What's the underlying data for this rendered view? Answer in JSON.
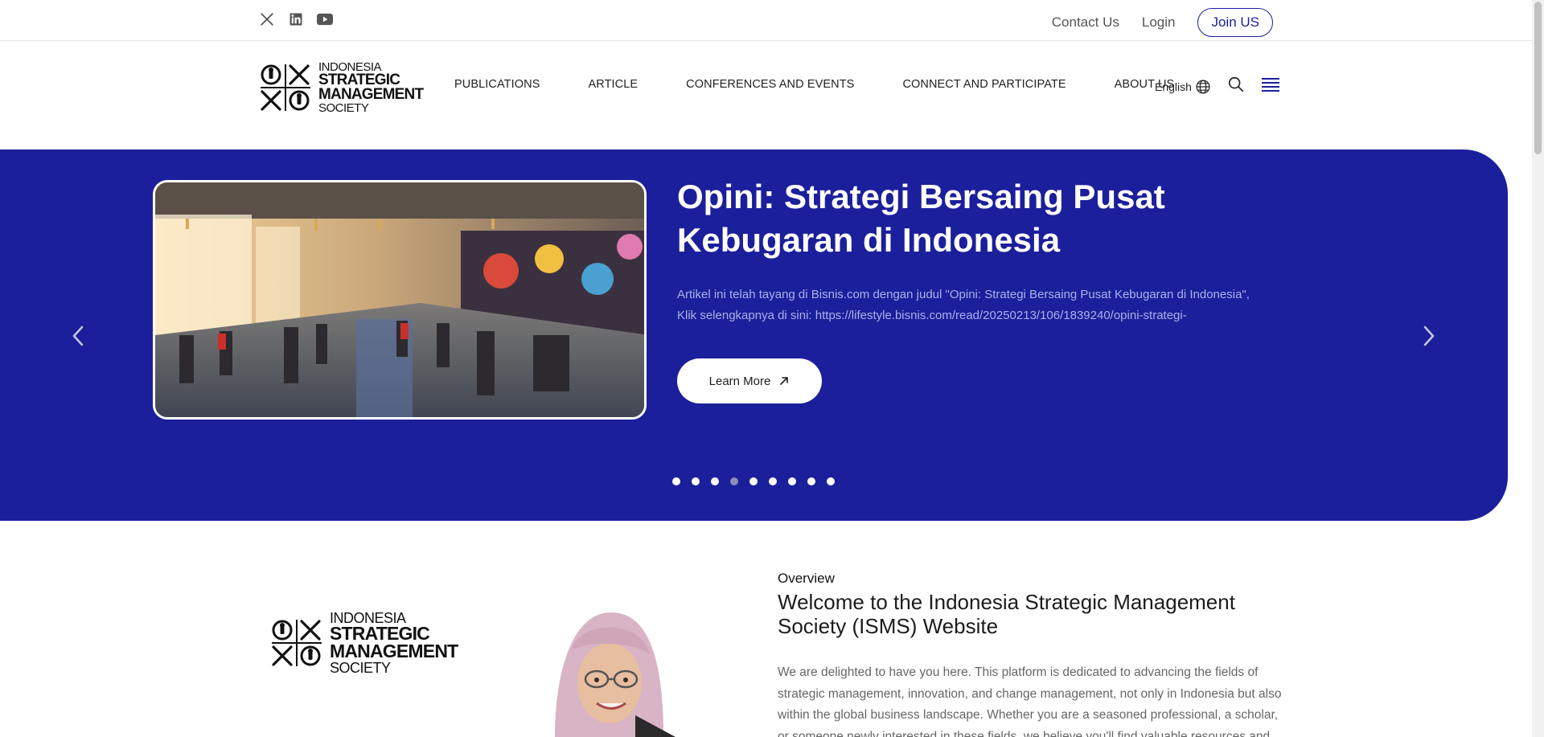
{
  "social": {
    "icons": [
      "x-icon",
      "linkedin-icon",
      "youtube-icon"
    ]
  },
  "toplinks": {
    "contact": "Contact Us",
    "login": "Login",
    "join": "Join US"
  },
  "logo": {
    "line1": "INDONESIA",
    "line2": "STRATEGIC",
    "line3": "MANAGEMENT",
    "line4": "SOCIETY"
  },
  "nav": {
    "items": [
      {
        "label": "PUBLICATIONS"
      },
      {
        "label": "ARTICLE"
      },
      {
        "label": "CONFERENCES AND EVENTS"
      },
      {
        "label": "CONNECT AND PARTICIPATE"
      },
      {
        "label": "ABOUT US"
      }
    ],
    "language": "English"
  },
  "hero": {
    "title": "Opini: Strategi Bersaing Pusat Kebugaran di Indonesia",
    "description": "Artikel ini telah tayang di Bisnis.com dengan judul \"Opini: Strategi Bersaing Pusat Kebugaran di Indonesia\", Klik selengkapnya di sini: https://lifestyle.bisnis.com/read/20250213/106/1839240/opini-strategi-",
    "button": "Learn More",
    "slide_count": 9,
    "active_slide": 4
  },
  "overview": {
    "label": "Overview",
    "title": "Welcome to the Indonesia Strategic Management Society (ISMS) Website",
    "text": "We are delighted to have you here. This platform is dedicated to advancing the fields of strategic management, innovation, and change management, not only in Indonesia but also within the global business landscape. Whether you are a seasoned professional, a scholar, or someone newly interested in these fields, we believe you'll find valuable resources and"
  },
  "colors": {
    "brand": "#1c1f9b",
    "button_border": "#1a1f9c",
    "muted_text": "#666666"
  }
}
